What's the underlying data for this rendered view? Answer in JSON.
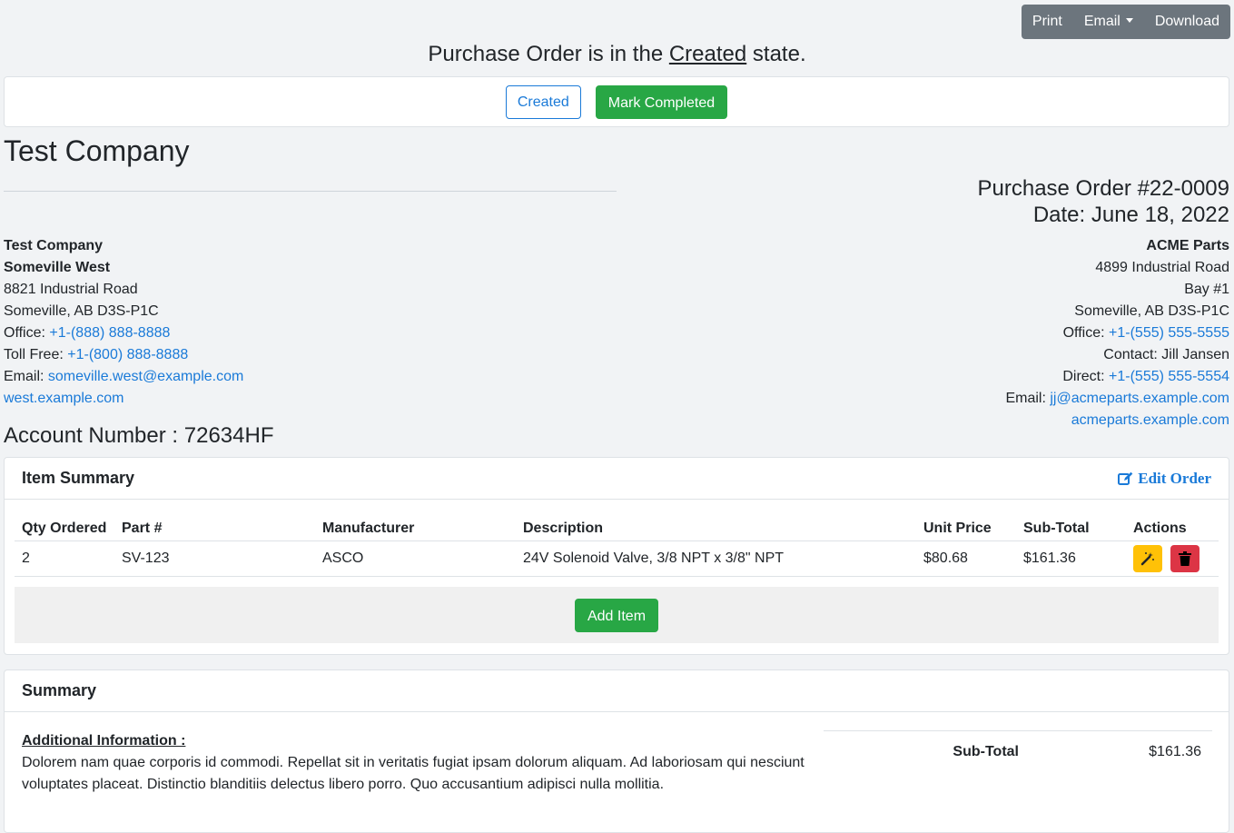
{
  "toolbar": {
    "print": "Print",
    "email": "Email",
    "download": "Download"
  },
  "status": {
    "prefix": "Purchase Order is in the",
    "state": "Created",
    "suffix": "state."
  },
  "state_buttons": {
    "current": "Created",
    "next": "Mark Completed"
  },
  "company": {
    "title": "Test Company"
  },
  "po": {
    "number": "Purchase Order #22-0009",
    "date": "Date: June 18, 2022"
  },
  "from": {
    "name": "Test Company",
    "branch": "Someville West",
    "street": "8821 Industrial Road",
    "city": "Someville, AB D3S-P1C",
    "office_label": "Office:",
    "office": "+1-(888) 888-8888",
    "tollfree_label": "Toll Free:",
    "tollfree": "+1-(800) 888-8888",
    "email_label": "Email:",
    "email": "someville.west@example.com",
    "website": "west.example.com"
  },
  "to": {
    "name": "ACME Parts",
    "street": "4899 Industrial Road",
    "unit": "Bay #1",
    "city": "Someville, AB D3S-P1C",
    "office_label": "Office:",
    "office": "+1-(555) 555-5555",
    "contact": "Contact: Jill Jansen",
    "direct_label": "Direct:",
    "direct": "+1-(555) 555-5554",
    "email_label": "Email:",
    "email": "jj@acmeparts.example.com",
    "website": "acmeparts.example.com"
  },
  "account": "Account Number : 72634HF",
  "items": {
    "title": "Item Summary",
    "edit": "Edit Order",
    "headers": [
      "Qty Ordered",
      "Part #",
      "Manufacturer",
      "Description",
      "Unit Price",
      "Sub-Total",
      "Actions"
    ],
    "rows": [
      [
        "2",
        "SV-123",
        "ASCO",
        "24V Solenoid Valve, 3/8 NPT x 3/8\" NPT",
        "$80.68",
        "$161.36"
      ]
    ],
    "add": "Add Item",
    "action_icons": [
      "wand-icon",
      "trash-icon"
    ]
  },
  "summary": {
    "title": "Summary",
    "info_title": "Additional Information :",
    "info_text": "Dolorem nam quae corporis id commodi. Repellat sit in veritatis fugiat ipsam dolorum aliquam. Ad laboriosam qui nesciunt voluptates placeat. Distinctio blanditiis delectus libero porro. Quo accusantium adipisci nulla mollitia.",
    "subtotal_label": "Sub-Total",
    "subtotal": "$161.36"
  },
  "colors": {
    "primary": "#1a7ad8",
    "success": "#28a745",
    "warning": "#ffc107",
    "danger": "#dc3545",
    "secondary": "#6c757d"
  }
}
